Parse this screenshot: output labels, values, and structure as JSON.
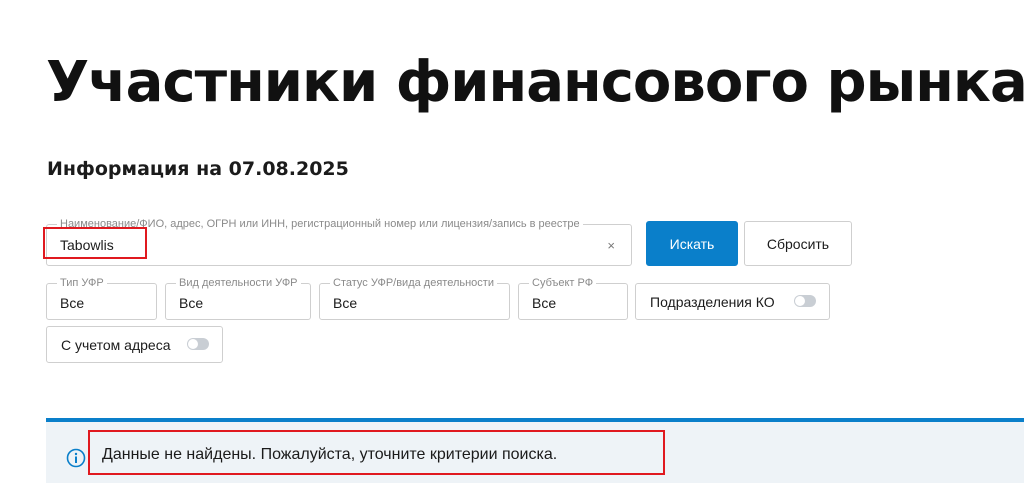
{
  "page": {
    "title": "Участники финансового рынка",
    "info_date": "Информация на 07.08.2025"
  },
  "search": {
    "label": "Наименование/ФИО, адрес, ОГРН или ИНН, регистрационный номер или лицензия/запись в реестре",
    "value": "Tabowlis",
    "clear_glyph": "×",
    "search_button": "Искать",
    "reset_button": "Сбросить"
  },
  "filters": [
    {
      "label": "Тип УФР",
      "value": "Все"
    },
    {
      "label": "Вид деятельности УФР",
      "value": "Все"
    },
    {
      "label": "Статус УФР/вида деятельности",
      "value": "Все"
    },
    {
      "label": "Субъект РФ",
      "value": "Все"
    }
  ],
  "toggles": [
    {
      "label": "Подразделения КО",
      "checked": false
    },
    {
      "label": "С учетом адреса",
      "checked": false
    }
  ],
  "alert": {
    "message": "Данные не найдены. Пожалуйста, уточните критерии поиска.",
    "icon": "info-icon"
  },
  "colors": {
    "accent": "#0a7fca",
    "highlight": "#e0191f",
    "alert_bg": "#eef3f7"
  }
}
